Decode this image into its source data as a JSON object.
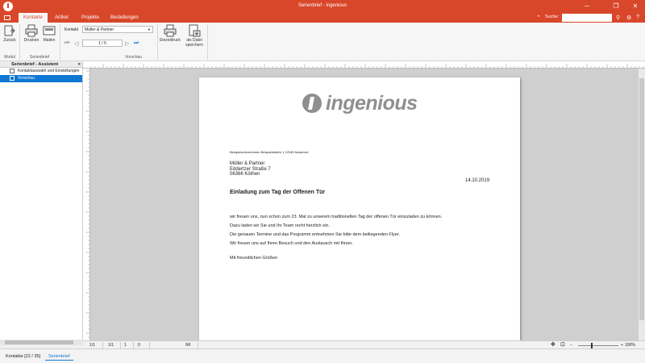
{
  "window": {
    "title": "Serienbrief - ingenious",
    "controls": [
      "minimize-icon",
      "restore-icon",
      "close-icon"
    ]
  },
  "tabs": [
    {
      "label": "Kontakte",
      "active": true
    },
    {
      "label": "Artikel",
      "active": false
    },
    {
      "label": "Projekte",
      "active": false
    },
    {
      "label": "Bestellungen",
      "active": false
    }
  ],
  "search": {
    "label": "Suche:",
    "value": ""
  },
  "ribbon": {
    "zurueck": "Zurück",
    "drucken": "Drucken",
    "mailen": "Mailen",
    "modul_label": "Modul",
    "serienbrief_label": "Serienbrief",
    "kontakt_label": "Kontakt",
    "kontakt_value": "Müller & Partner",
    "page_value": "1 / 5",
    "einzeldruck": "Einzeldruck",
    "datei_line1": "als Datei",
    "datei_line2": "speichern",
    "vorschau_label": "Vorschau"
  },
  "left_panel": {
    "header": "Serienbrief - Assistent",
    "items": [
      {
        "label": "Kontaktauswahl und Einstellungen",
        "selected": false
      },
      {
        "label": "Vorschau",
        "selected": true
      }
    ]
  },
  "letter": {
    "logo_text": "ingenious",
    "sender_line": "Beispielunternehmen   Beispielstraße 1   12345 Musterort",
    "recipient": [
      "Müller & Partner",
      "Eddertzer Straße 7",
      "06366 Köthen"
    ],
    "date": "14.10.2019",
    "subject": "Einladung zum Tag der Offenen Tür",
    "body": [
      "wir freuen uns, nun schon zum 23. Mal zu unserem traditionellen Tag der offenen Tür einzuladen zu können.",
      "Dazu laden wir Sie und Ihr Team recht herzlich ein.",
      "Die genauen Termine und das Programm entnehmen Sie bitte dem beiliegenden Flyer.",
      "Wir freuen uns auf Ihren Besuch und den Austausch mit Ihnen."
    ],
    "closing": "Mit freundlichen Grüßen"
  },
  "statusbar": {
    "page1": "1/1",
    "page2": "1/1",
    "col": "1",
    "pos": "0",
    "mode": "NF",
    "zoom": "100%",
    "zoom_level": 1.0
  },
  "bottom_tabs": [
    {
      "label": "Kontakte [22 / 35]",
      "active": false
    },
    {
      "label": "Serienbrief",
      "active": true
    }
  ],
  "colors": {
    "accent": "#d9472b",
    "selection": "#0f77d3"
  }
}
